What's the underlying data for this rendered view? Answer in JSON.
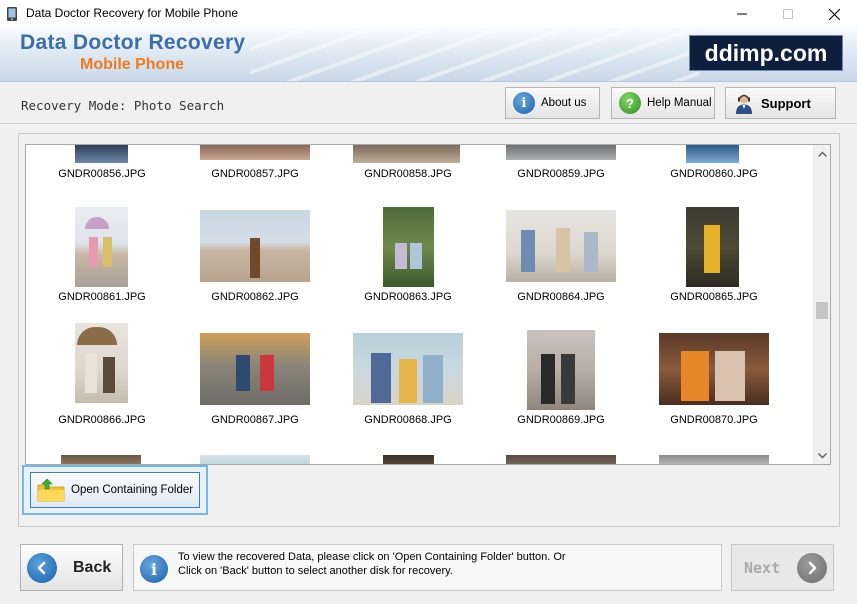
{
  "window": {
    "title": "Data Doctor Recovery for Mobile Phone"
  },
  "banner": {
    "brand_line1": "Data Doctor Recovery",
    "brand_line2": "Mobile Phone",
    "logo_text": "ddimp.com"
  },
  "header": {
    "mode_label": "Recovery Mode: Photo Search",
    "about_label": "About us",
    "help_label": "Help Manual",
    "support_label": "Support"
  },
  "gallery": {
    "rows": [
      [
        "GNDR00856.JPG",
        "GNDR00857.JPG",
        "GNDR00858.JPG",
        "GNDR00859.JPG",
        "GNDR00860.JPG"
      ],
      [
        "GNDR00861.JPG",
        "GNDR00862.JPG",
        "GNDR00863.JPG",
        "GNDR00864.JPG",
        "GNDR00865.JPG"
      ],
      [
        "GNDR00866.JPG",
        "GNDR00867.JPG",
        "GNDR00868.JPG",
        "GNDR00869.JPG",
        "GNDR00870.JPG"
      ]
    ]
  },
  "actions": {
    "open_folder_label": "Open Containing Folder"
  },
  "footer": {
    "back_label": "Back",
    "next_label": "Next",
    "info_line1": "To view the recovered Data, please click on 'Open Containing Folder' button. Or",
    "info_line2": "Click on 'Back' button to select another disk for recovery."
  },
  "colors": {
    "brand_blue": "#3c6ea8",
    "brand_orange": "#f07a21",
    "logo_bg": "#0d1f3c",
    "focus_border": "#7ab5e6"
  }
}
